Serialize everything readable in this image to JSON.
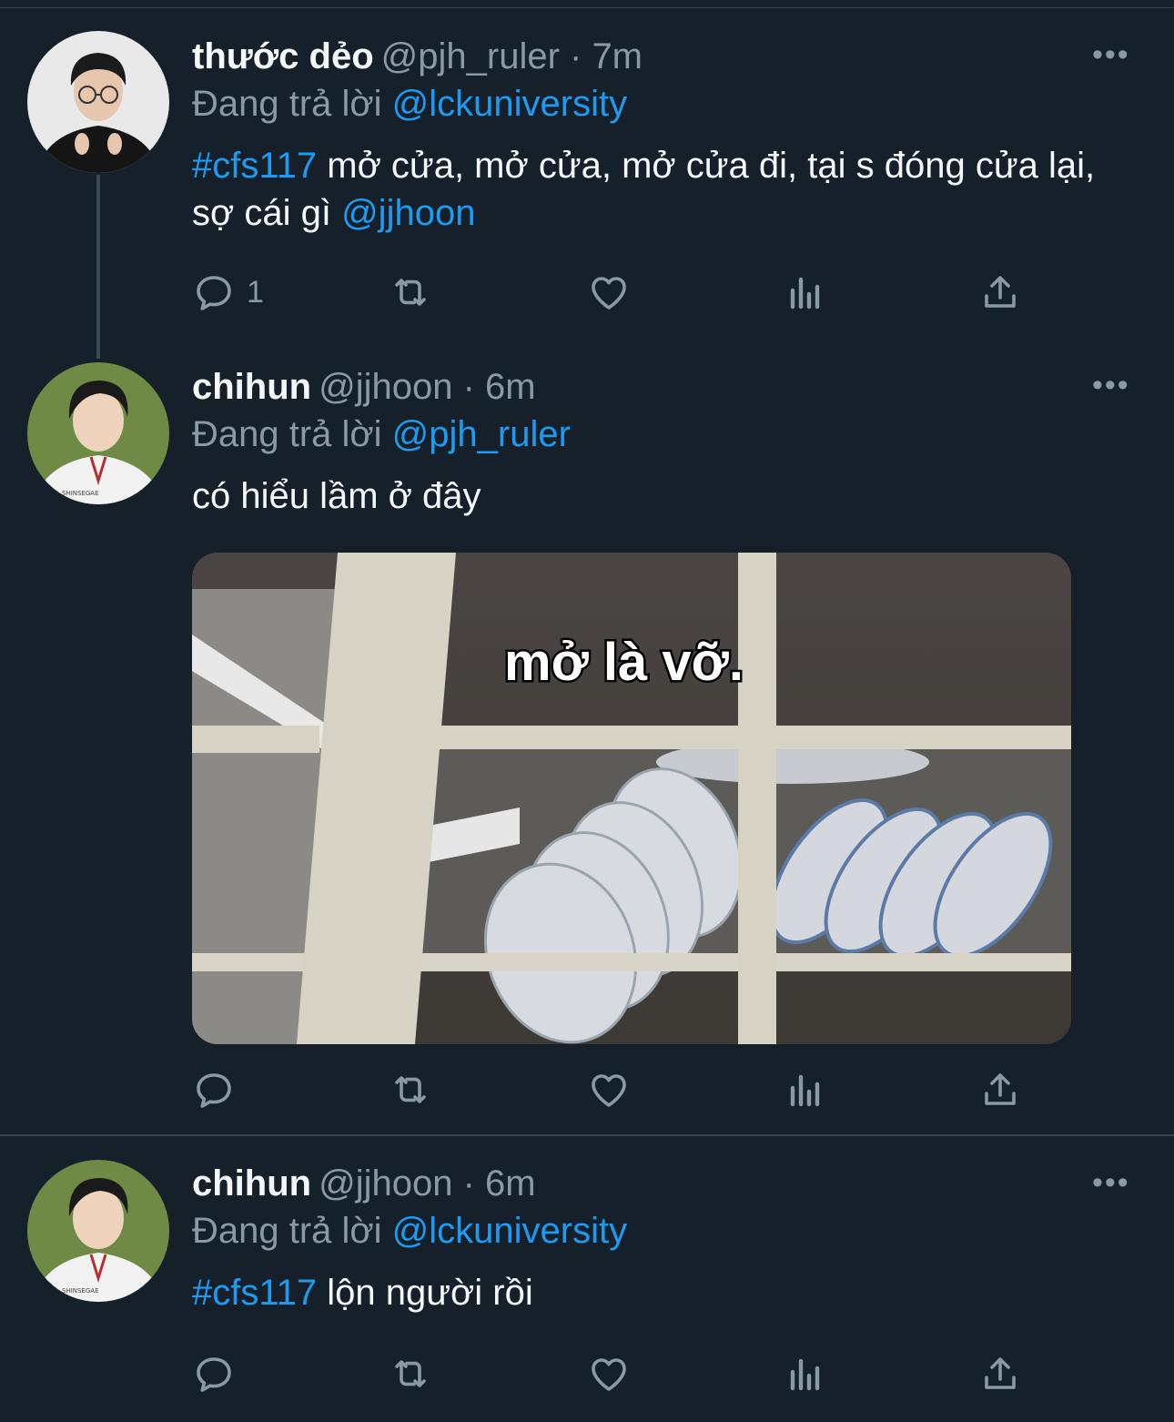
{
  "tweets": [
    {
      "name": "thước dẻo",
      "handle": "@pjh_ruler",
      "time": "7m",
      "replying_prefix": "Đang trả lời",
      "replying_to": "@lckuniversity",
      "hashtag": "#cfs117",
      "text": "mở cửa, mở cửa, mở cửa đi, tại s đóng cửa lại, sợ cái gì",
      "mention": "@jjhoon",
      "reply_count": "1"
    },
    {
      "name": "chihun",
      "handle": "@jjhoon",
      "time": "6m",
      "replying_prefix": "Đang trả lời",
      "replying_to": "@pjh_ruler",
      "text": "có hiểu lầm ở đây",
      "media_caption": "mở là vỡ."
    },
    {
      "name": "chihun",
      "handle": "@jjhoon",
      "time": "6m",
      "replying_prefix": "Đang trả lời",
      "replying_to": "@lckuniversity",
      "hashtag": "#cfs117",
      "text": "lộn người rồi"
    }
  ],
  "icons": {
    "more": "more-horizontal-icon",
    "reply": "reply-icon",
    "retweet": "retweet-icon",
    "like": "heart-icon",
    "views": "analytics-icon",
    "share": "share-icon"
  },
  "colors": {
    "background": "#15202b",
    "link": "#1d9bf0",
    "secondary": "#8b98a5",
    "primary_text": "#f5f8fa",
    "divider": "#38444d"
  }
}
